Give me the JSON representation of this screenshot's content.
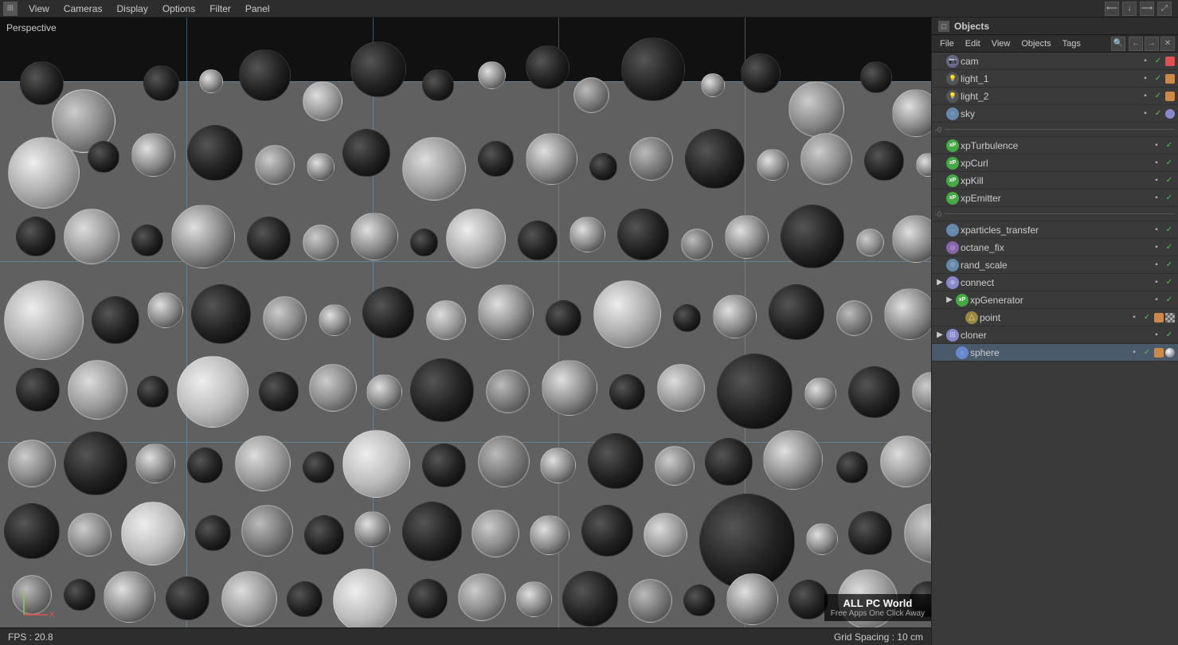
{
  "app": {
    "title": "Objects"
  },
  "menubar": {
    "items": [
      "View",
      "Cameras",
      "Display",
      "Options",
      "Filter",
      "Panel"
    ]
  },
  "viewport": {
    "label": "Perspective",
    "fps": "FPS : 20.8",
    "grid_spacing": "Grid Spacing : 10 cm"
  },
  "panel": {
    "title": "Objects",
    "menu_items": [
      "File",
      "Edit",
      "View",
      "Objects",
      "Tags"
    ],
    "toolbar_icons": [
      "search",
      "gear",
      "arrow-left",
      "arrow-right",
      "close"
    ]
  },
  "objects": [
    {
      "id": "cam",
      "name": "cam",
      "indent": 0,
      "icon_color": "#aaa",
      "icon_type": "camera",
      "color_dot": "#e05050",
      "has_check": true,
      "checked": true
    },
    {
      "id": "light_1",
      "name": "light_1",
      "indent": 0,
      "icon_color": "#aaa",
      "icon_type": "light",
      "color_dot": "#cc8844",
      "has_check": true,
      "checked": true
    },
    {
      "id": "light_2",
      "name": "light_2",
      "indent": 0,
      "icon_color": "#aaa",
      "icon_type": "light",
      "color_dot": "#cc8844",
      "has_check": true,
      "checked": true
    },
    {
      "id": "sky",
      "name": "sky",
      "indent": 0,
      "icon_color": "#8888cc",
      "icon_type": "sky",
      "color_dot": "#aaaaee",
      "has_check": true,
      "checked": true
    },
    {
      "id": "sep1",
      "type": "separator"
    },
    {
      "id": "xpTurbulence",
      "name": "xpTurbulence",
      "indent": 0,
      "icon_color": "#44cc44",
      "icon_type": "xp",
      "has_check": true,
      "checked": true
    },
    {
      "id": "xpCurl",
      "name": "xpCurl",
      "indent": 0,
      "icon_color": "#44cc44",
      "icon_type": "xp",
      "has_check": true,
      "checked": true
    },
    {
      "id": "xpKill",
      "name": "xpKill",
      "indent": 0,
      "icon_color": "#44cc44",
      "icon_type": "xp-kill",
      "has_check": true,
      "checked": true
    },
    {
      "id": "xpEmitter",
      "name": "xpEmitter",
      "indent": 0,
      "icon_color": "#44cc44",
      "icon_type": "xp-emit",
      "has_check": true,
      "checked": true
    },
    {
      "id": "sep2",
      "type": "separator"
    },
    {
      "id": "xparticles_transfer",
      "name": "xparticles_transfer",
      "indent": 0,
      "icon_color": "#8888cc",
      "icon_type": "xp-trans",
      "has_check": true,
      "checked": true
    },
    {
      "id": "octane_fix",
      "name": "octane_fix",
      "indent": 0,
      "icon_color": "#8888cc",
      "icon_type": "octane",
      "has_check": true,
      "checked": true
    },
    {
      "id": "rand_scale",
      "name": "rand_scale",
      "indent": 0,
      "icon_color": "#aaa",
      "icon_type": "generic",
      "has_check": true,
      "checked": true
    },
    {
      "id": "connect",
      "name": "connect",
      "indent": 0,
      "icon_color": "#8888cc",
      "icon_type": "connect",
      "has_check": true,
      "checked": true,
      "expandable": true
    },
    {
      "id": "xpGenerator",
      "name": "xpGenerator",
      "indent": 1,
      "icon_color": "#44cc44",
      "icon_type": "xp-gen",
      "has_check": true,
      "checked": true,
      "expandable": true
    },
    {
      "id": "point",
      "name": "point",
      "indent": 2,
      "icon_color": "#ccaa44",
      "icon_type": "point",
      "color_dot": "#cc8844",
      "has_check": true,
      "checked": true
    },
    {
      "id": "cloner",
      "name": "cloner",
      "indent": 0,
      "icon_color": "#8888cc",
      "icon_type": "cloner",
      "has_check": true,
      "checked": true,
      "expandable": true
    },
    {
      "id": "sphere",
      "name": "sphere",
      "indent": 1,
      "icon_color": "#aaaaee",
      "icon_type": "sphere",
      "color_dot1": "#cc8844",
      "color_dot2": "#cccccc",
      "has_check": true,
      "checked": true
    }
  ]
}
